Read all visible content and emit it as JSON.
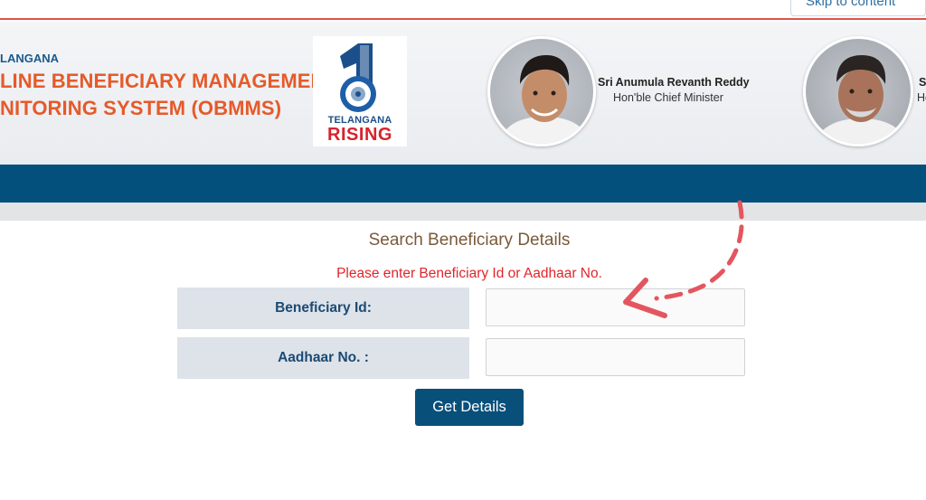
{
  "skip_link": "Skip to content",
  "header": {
    "state_label": "LANGANA",
    "title_line1": "LINE BENEFICIARY MANAGEMENT &",
    "title_line2": "NITORING SYSTEM (OBMMS)",
    "logo": {
      "line1": "TELANGANA",
      "line2": "RISING"
    },
    "person1": {
      "name": "Sri Anumula Revanth Reddy",
      "role": "Hon'ble Chief Minister"
    },
    "person2": {
      "name": "S",
      "role": "Ho"
    }
  },
  "form": {
    "heading": "Search Beneficiary Details",
    "hint": "Please enter Beneficiary Id or Aadhaar No.",
    "beneficiary_label": "Beneficiary Id:",
    "beneficiary_value": "",
    "aadhaar_label": "Aadhaar No. :",
    "aadhaar_value": "",
    "submit_label": "Get Details"
  },
  "colors": {
    "title": "#e55a2a",
    "navbar": "#03507d",
    "hint": "#e0252b",
    "button": "#084f7a",
    "annotation_arrow": "#e3565f"
  },
  "icons": {
    "logo": "telangana-rising-logo",
    "annotation": "dashed-curved-arrow-icon"
  }
}
